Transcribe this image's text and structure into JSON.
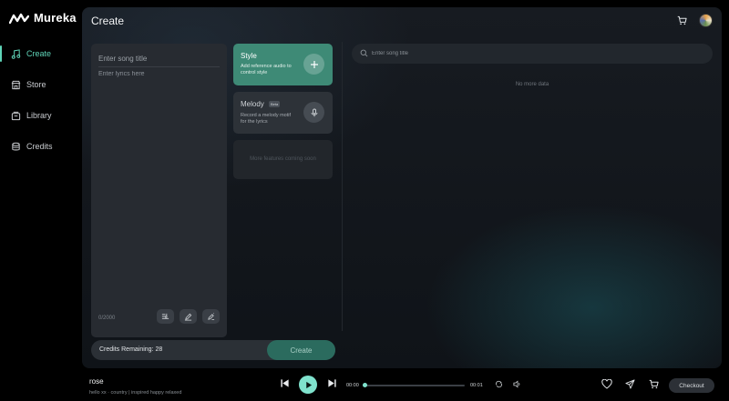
{
  "app": {
    "name": "Mureka"
  },
  "sidebar": {
    "items": [
      {
        "label": "Create",
        "icon": "music-note-icon",
        "active": true
      },
      {
        "label": "Store",
        "icon": "store-icon",
        "active": false
      },
      {
        "label": "Library",
        "icon": "library-icon",
        "active": false
      },
      {
        "label": "Credits",
        "icon": "credits-icon",
        "active": false
      }
    ],
    "socials": [
      "instagram-icon",
      "x-icon",
      "tiktok-icon",
      "youtube-icon",
      "discord-icon"
    ]
  },
  "main": {
    "title": "Create",
    "lyrics": {
      "title_placeholder": "Enter song title",
      "lyrics_placeholder": "Enter lyrics here",
      "char_count": "0/2000"
    },
    "style_card": {
      "title": "Style",
      "description": "Add reference audio to control style"
    },
    "melody_card": {
      "title": "Melody",
      "badge": "Beta",
      "description": "Record a melody motif for the lyrics"
    },
    "more_card": {
      "text": "More features coming soon"
    },
    "credits_label": "Credits Remaining: 28",
    "create_label": "Create",
    "search": {
      "placeholder": "Enter song title"
    },
    "no_data": "No more data"
  },
  "player": {
    "song_title": "rose",
    "song_meta": "hello xx · country | inspired happy relaxed",
    "time_current": "00:00",
    "time_total": "00:01",
    "progress": 0.0,
    "checkout_label": "Checkout"
  },
  "colors": {
    "accent": "#5fd4b8",
    "style_card": "#3e8a76",
    "create_button": "#2b6b5e",
    "play_button": "#7fe2cd"
  }
}
